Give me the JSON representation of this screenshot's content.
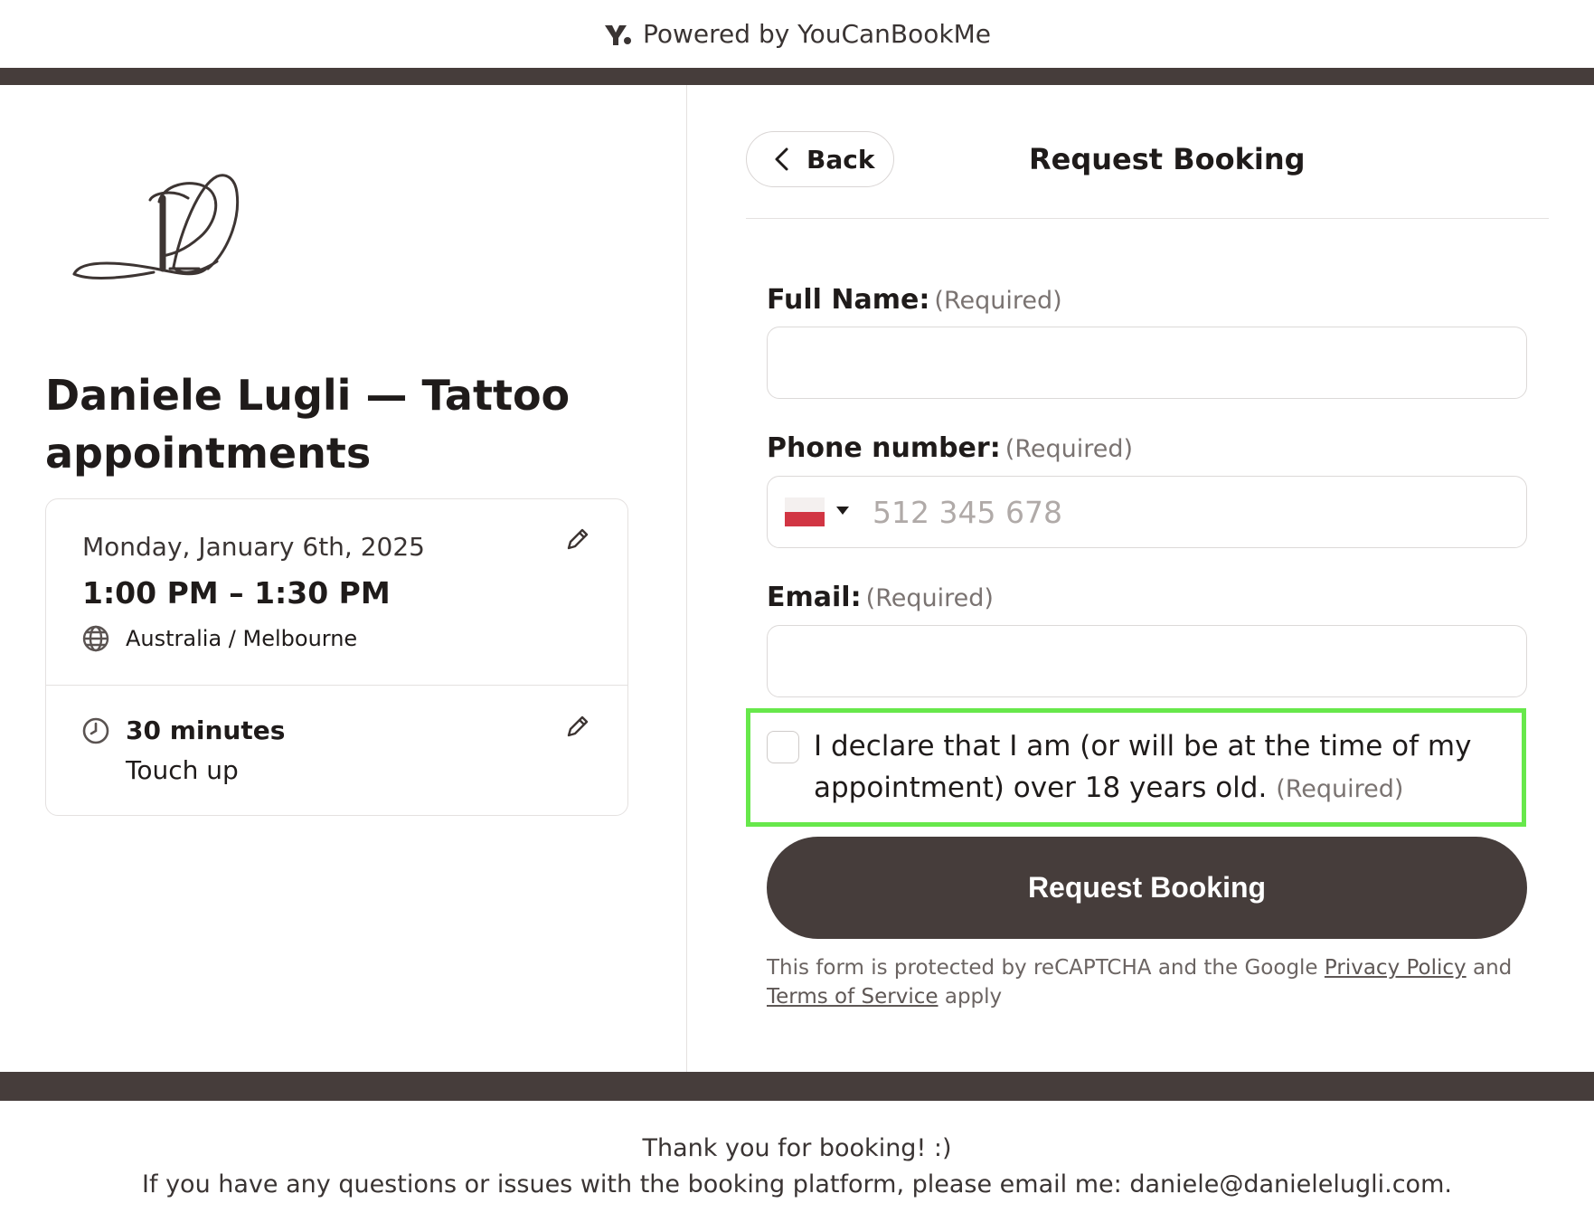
{
  "header": {
    "powered_by": "Powered by YouCanBookMe"
  },
  "left": {
    "title": "Daniele Lugli — Tattoo appointments",
    "date": "Monday, January 6th, 2025",
    "time_range": "1:00 PM – 1:30 PM",
    "timezone": "Australia / Melbourne",
    "duration": "30 minutes",
    "service": "Touch up"
  },
  "form": {
    "back_label": "Back",
    "heading": "Request Booking",
    "required_hint": "(Required)",
    "full_name_label": "Full Name:",
    "phone_label": "Phone number:",
    "phone_placeholder": "512 345 678",
    "email_label": "Email:",
    "consent_text": "I declare that I am (or will be at the time of my appointment) over 18 years old.",
    "submit_label": "Request Booking",
    "legal_prefix": "This form is protected by reCAPTCHA and the Google",
    "privacy_link": "Privacy Policy",
    "legal_and": "and",
    "terms_link": "Terms of Service",
    "legal_suffix": "apply"
  },
  "footer": {
    "line1": "Thank you for booking! :)",
    "line2": "If you have any questions or issues with the booking platform, please email me: daniele@danielelugli.com."
  },
  "colors": {
    "brand_dark": "#463d3b",
    "highlight": "#67e84b",
    "flag_red": "#d13543"
  },
  "icons": [
    "youcanbookme-logo-icon",
    "edit-pencil-icon",
    "globe-icon",
    "clock-icon",
    "chevron-left-icon",
    "flag-icon"
  ]
}
